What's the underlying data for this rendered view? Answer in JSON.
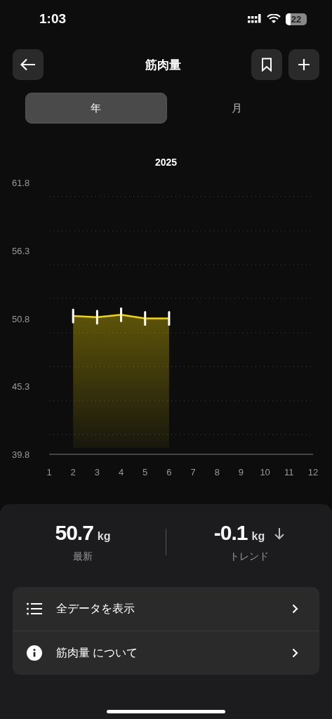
{
  "status_bar": {
    "time": "1:03",
    "battery": "22"
  },
  "header": {
    "title": "筋肉量"
  },
  "tabs": [
    {
      "label": "年",
      "selected": true
    },
    {
      "label": "月",
      "selected": false
    }
  ],
  "chart": {
    "chart_data": {
      "type": "line",
      "title": "2025",
      "x": [
        2,
        3,
        4,
        5,
        6
      ],
      "series": [
        {
          "color": "#f2d600",
          "values": [
            51.0,
            50.9,
            51.1,
            50.8,
            50.8
          ]
        }
      ],
      "xlim": [
        1,
        12
      ],
      "ylim": [
        39.8,
        61.8
      ],
      "xticks": [
        1,
        2,
        3,
        4,
        5,
        6,
        7,
        8,
        9,
        10,
        11,
        12
      ],
      "yticks": [
        39.8,
        45.3,
        50.8,
        56.3,
        61.8
      ]
    }
  },
  "stats": [
    {
      "value": "50.7",
      "unit": "kg",
      "label": "最新"
    },
    {
      "value": "-0.1",
      "unit": "kg",
      "label": "トレンド",
      "falling": true
    }
  ],
  "menu": [
    {
      "kind": "list",
      "label": "全データを表示"
    },
    {
      "kind": "info",
      "label": "筋肉量 について"
    }
  ]
}
